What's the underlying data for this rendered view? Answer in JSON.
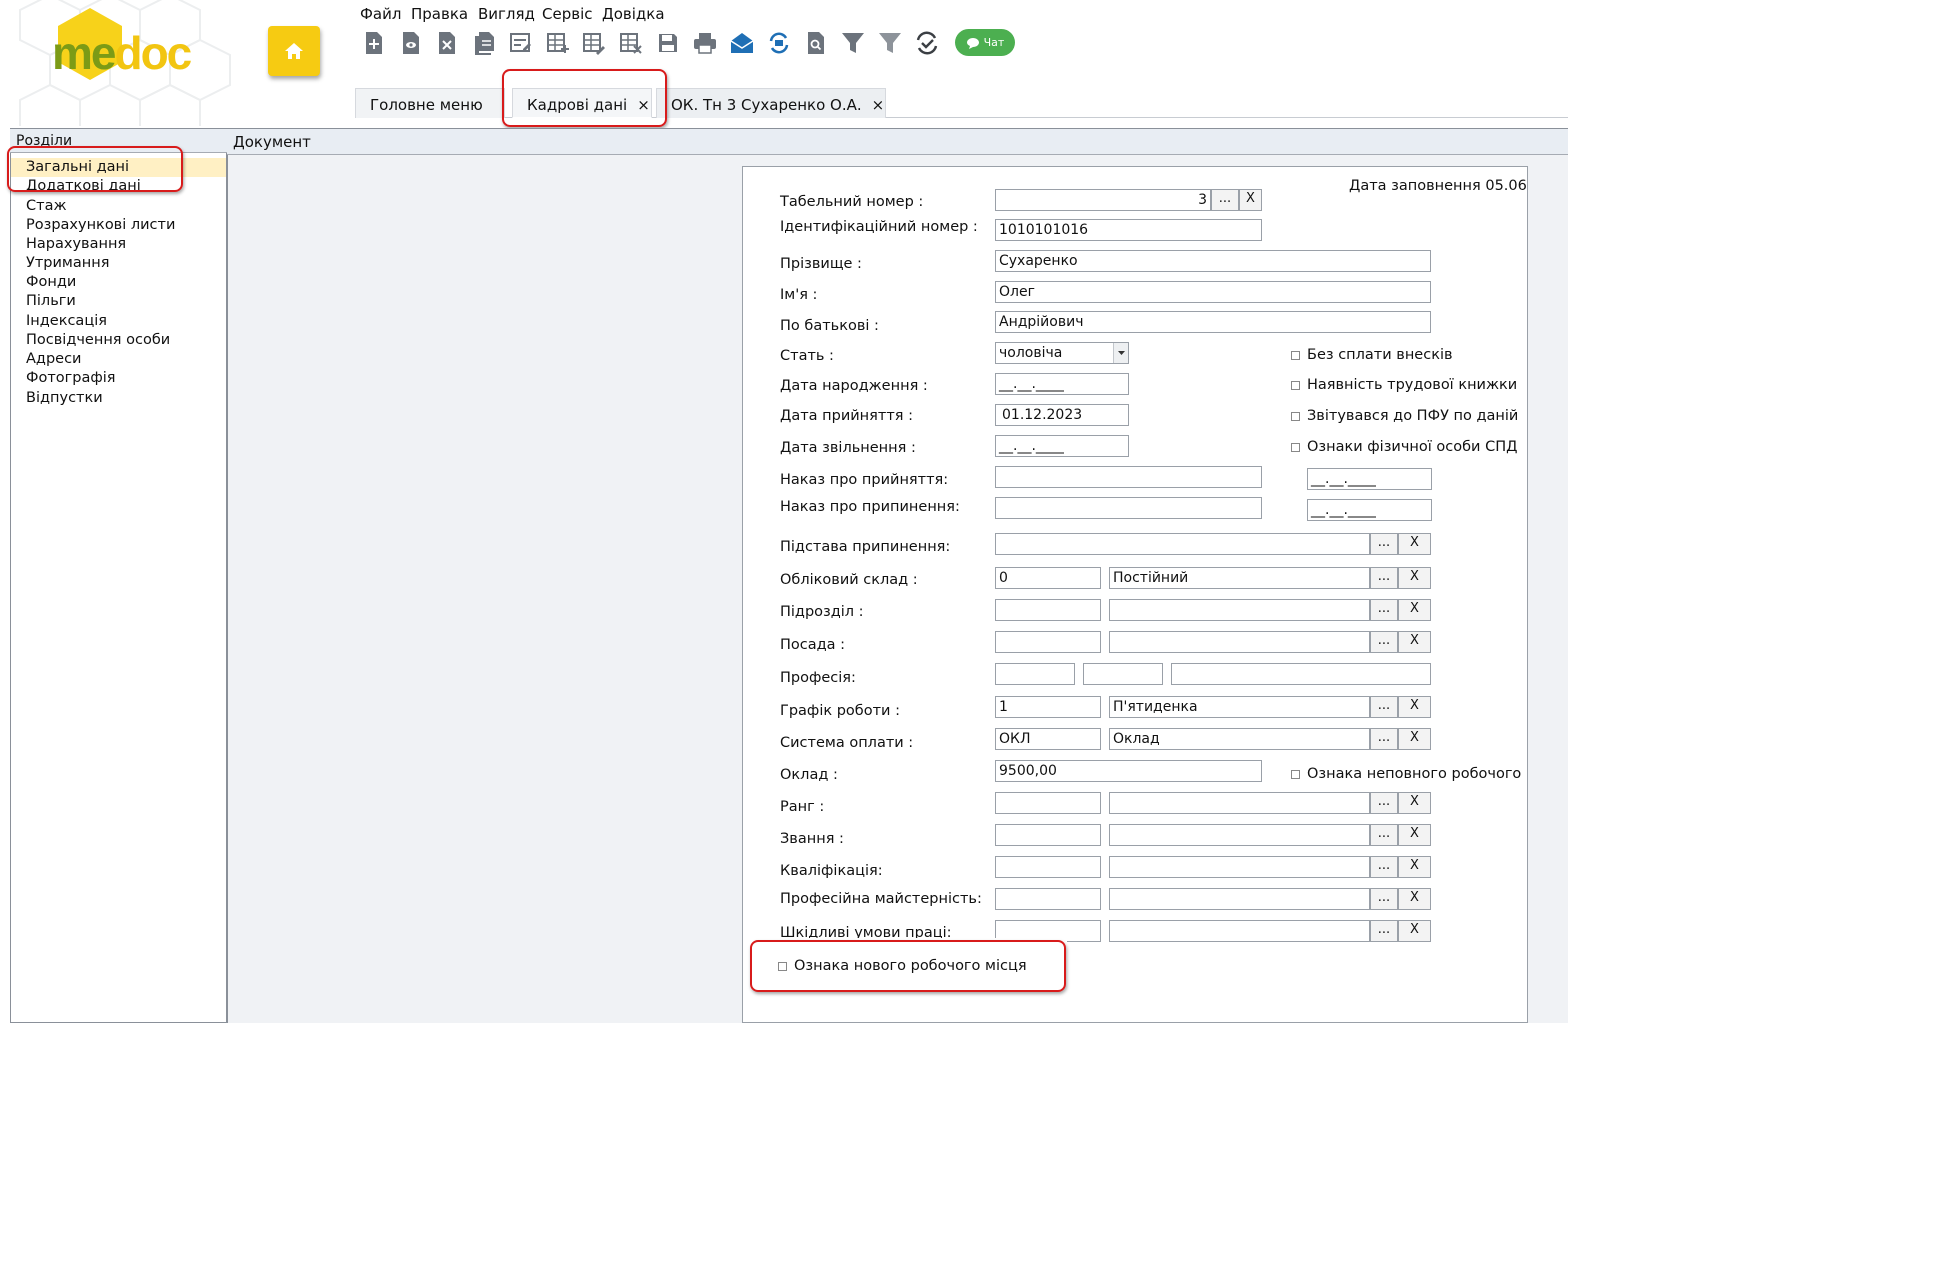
{
  "app": {
    "logo_me": "me",
    "logo_doc": "doc"
  },
  "menu": [
    "Файл",
    "Правка",
    "Вигляд",
    "Сервіс",
    "Довідка"
  ],
  "toolbar": {
    "icons": [
      "add-doc-icon",
      "view-icon",
      "delete-doc-icon",
      "copy-doc-icon",
      "edit-icon",
      "add-table-icon",
      "edit-table-icon",
      "delete-table-icon",
      "save-icon",
      "print-icon",
      "mail-icon",
      "exchange-icon",
      "search-icon",
      "filter-icon",
      "filter-clear-icon",
      "sync-icon"
    ],
    "chat_label": "Чат"
  },
  "tabs": [
    {
      "label": "Головне меню"
    },
    {
      "label": "Кадрові дані",
      "close": "×"
    },
    {
      "label": "ОК. Тн 3 Сухаренко О.А.",
      "close": "×"
    }
  ],
  "sidebar": {
    "title": "Розділи",
    "items": [
      "Загальні дані",
      "Додаткові дані",
      "Стаж",
      "Розрахункові листи",
      "Нарахування",
      "Утримання",
      "Фонди",
      "Пільги",
      "Індексація",
      "Посвідчення особи",
      "Адреси",
      "Фотографія",
      "Відпустки"
    ]
  },
  "document": {
    "header": "Документ",
    "fill_date": "Дата заповнення 05.06",
    "labels": {
      "tab_num": "Табельний номер :",
      "id_num": "Ідентифікаційний номер :",
      "surname": "Прізвище :",
      "name": "Ім'я :",
      "patronymic": "По батькові :",
      "sex": "Стать :",
      "birth": "Дата народження :",
      "hire": "Дата прийняття :",
      "fire": "Дата звільнення :",
      "order_hire": "Наказ про прийняття:",
      "order_end": "Наказ про припинення:",
      "end_reason": "Підстава припинення:",
      "staff": "Обліковий склад :",
      "division": "Підрозділ :",
      "position": "Посада :",
      "profession": "Професія:",
      "schedule": "Графік роботи :",
      "pay_system": "Система оплати :",
      "salary": "Оклад :",
      "rank": "Ранг :",
      "title": "Звання :",
      "qualification": "Кваліфікація:",
      "mastery": "Професійна майстерність:",
      "harmful": "Шкідливі умови праці:"
    },
    "values": {
      "tab_num": "3",
      "id_num": "1010101016",
      "surname": "Сухаренко",
      "name": "Олег",
      "patronymic": "Андрійович",
      "sex": "чоловіча",
      "birth": "__.__.____",
      "hire": "01.12.2023",
      "fire": "__.__.____",
      "order_hire_date": "__.__.____",
      "order_end_date": "__.__.____",
      "staff_code": "0",
      "staff_name": "Постійний",
      "schedule_code": "1",
      "schedule_name": "П'ятиденка",
      "pay_code": "ОКЛ",
      "pay_name": "Оклад",
      "salary": "9500,00"
    },
    "checkboxes": {
      "no_contrib": "Без сплати внесків",
      "work_book": "Наявність трудової книжки",
      "pfu": "Звітувався до ПФУ по даній у",
      "spd": "Ознаки фізичної особи СПД",
      "part_time": "Ознака неповного робочого ч",
      "new_workplace": "Ознака нового робочого місця"
    },
    "btn_more": "...",
    "btn_clear": "X"
  },
  "colors": {
    "accent_red": "#d81b1b",
    "home_yellow": "#f6cb12",
    "chat_green": "#4caf50",
    "selected_bg": "#fff0c4"
  }
}
